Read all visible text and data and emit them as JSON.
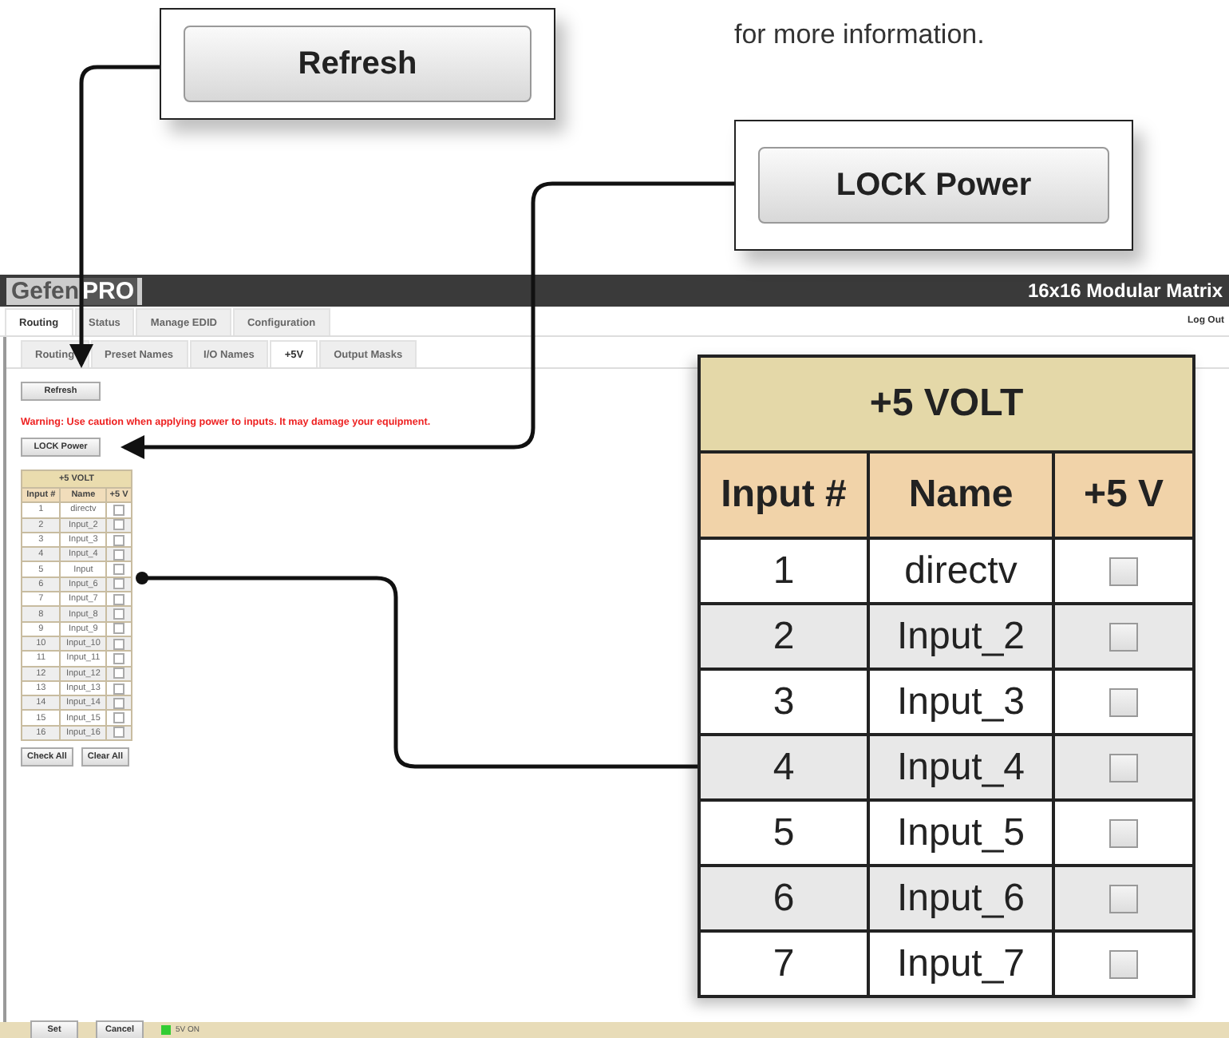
{
  "doc_text": "for more information.",
  "callouts": [
    {
      "kind": "refresh",
      "label": "Refresh"
    },
    {
      "kind": "lock",
      "label": "LOCK Power"
    }
  ],
  "app": {
    "logo": {
      "left": "Gefen",
      "right": "PRO"
    },
    "product": "16x16 Modular Matrix",
    "main_tabs": [
      {
        "label": "Routing",
        "selected": true
      },
      {
        "label": "Status",
        "selected": false
      },
      {
        "label": "Manage EDID",
        "selected": false
      },
      {
        "label": "Configuration",
        "selected": false
      }
    ],
    "log_out": "Log Out",
    "sub_tabs": [
      {
        "label": "Routing",
        "selected": false
      },
      {
        "label": "Preset Names",
        "selected": false
      },
      {
        "label": "I/O Names",
        "selected": false
      },
      {
        "label": "+5V",
        "selected": true
      },
      {
        "label": "Output Masks",
        "selected": false
      }
    ],
    "refresh": "Refresh",
    "warning": "Warning: Use caution when applying power to inputs. It may damage your equipment.",
    "lock": "LOCK Power",
    "table": {
      "title": "+5 VOLT",
      "columns": [
        "Input #",
        "Name",
        "+5 V"
      ],
      "rows": [
        {
          "input": "1",
          "name": "directv",
          "checked": false
        },
        {
          "input": "2",
          "name": "Input_2",
          "checked": false
        },
        {
          "input": "3",
          "name": "Input_3",
          "checked": false
        },
        {
          "input": "4",
          "name": "Input_4",
          "checked": false
        },
        {
          "input": "5",
          "name": "Input",
          "checked": false
        },
        {
          "input": "6",
          "name": "Input_6",
          "checked": false
        },
        {
          "input": "7",
          "name": "Input_7",
          "checked": false
        },
        {
          "input": "8",
          "name": "Input_8",
          "checked": false
        },
        {
          "input": "9",
          "name": "Input_9",
          "checked": false
        },
        {
          "input": "10",
          "name": "Input_10",
          "checked": false
        },
        {
          "input": "11",
          "name": "Input_11",
          "checked": false
        },
        {
          "input": "12",
          "name": "Input_12",
          "checked": false
        },
        {
          "input": "13",
          "name": "Input_13",
          "checked": false
        },
        {
          "input": "14",
          "name": "Input_14",
          "checked": false
        },
        {
          "input": "15",
          "name": "Input_15",
          "checked": false
        },
        {
          "input": "16",
          "name": "Input_16",
          "checked": false
        }
      ]
    },
    "table_buttons": [
      "Check All",
      "Clear All"
    ],
    "footer": {
      "buttons": [
        "Set",
        "Cancel"
      ],
      "indicator": {
        "label": "5V ON",
        "on": true
      }
    }
  },
  "magnified_table": {
    "title": "+5 VOLT",
    "columns": [
      "Input #",
      "Name",
      "+5 V"
    ],
    "rows": [
      {
        "input": "1",
        "name": "directv",
        "checked": false
      },
      {
        "input": "2",
        "name": "Input_2",
        "checked": false
      },
      {
        "input": "3",
        "name": "Input_3",
        "checked": false
      },
      {
        "input": "4",
        "name": "Input_4",
        "checked": false
      },
      {
        "input": "5",
        "name": "Input_5",
        "checked": false
      },
      {
        "input": "6",
        "name": "Input_6",
        "checked": false
      },
      {
        "input": "7",
        "name": "Input_7",
        "checked": false
      }
    ]
  }
}
